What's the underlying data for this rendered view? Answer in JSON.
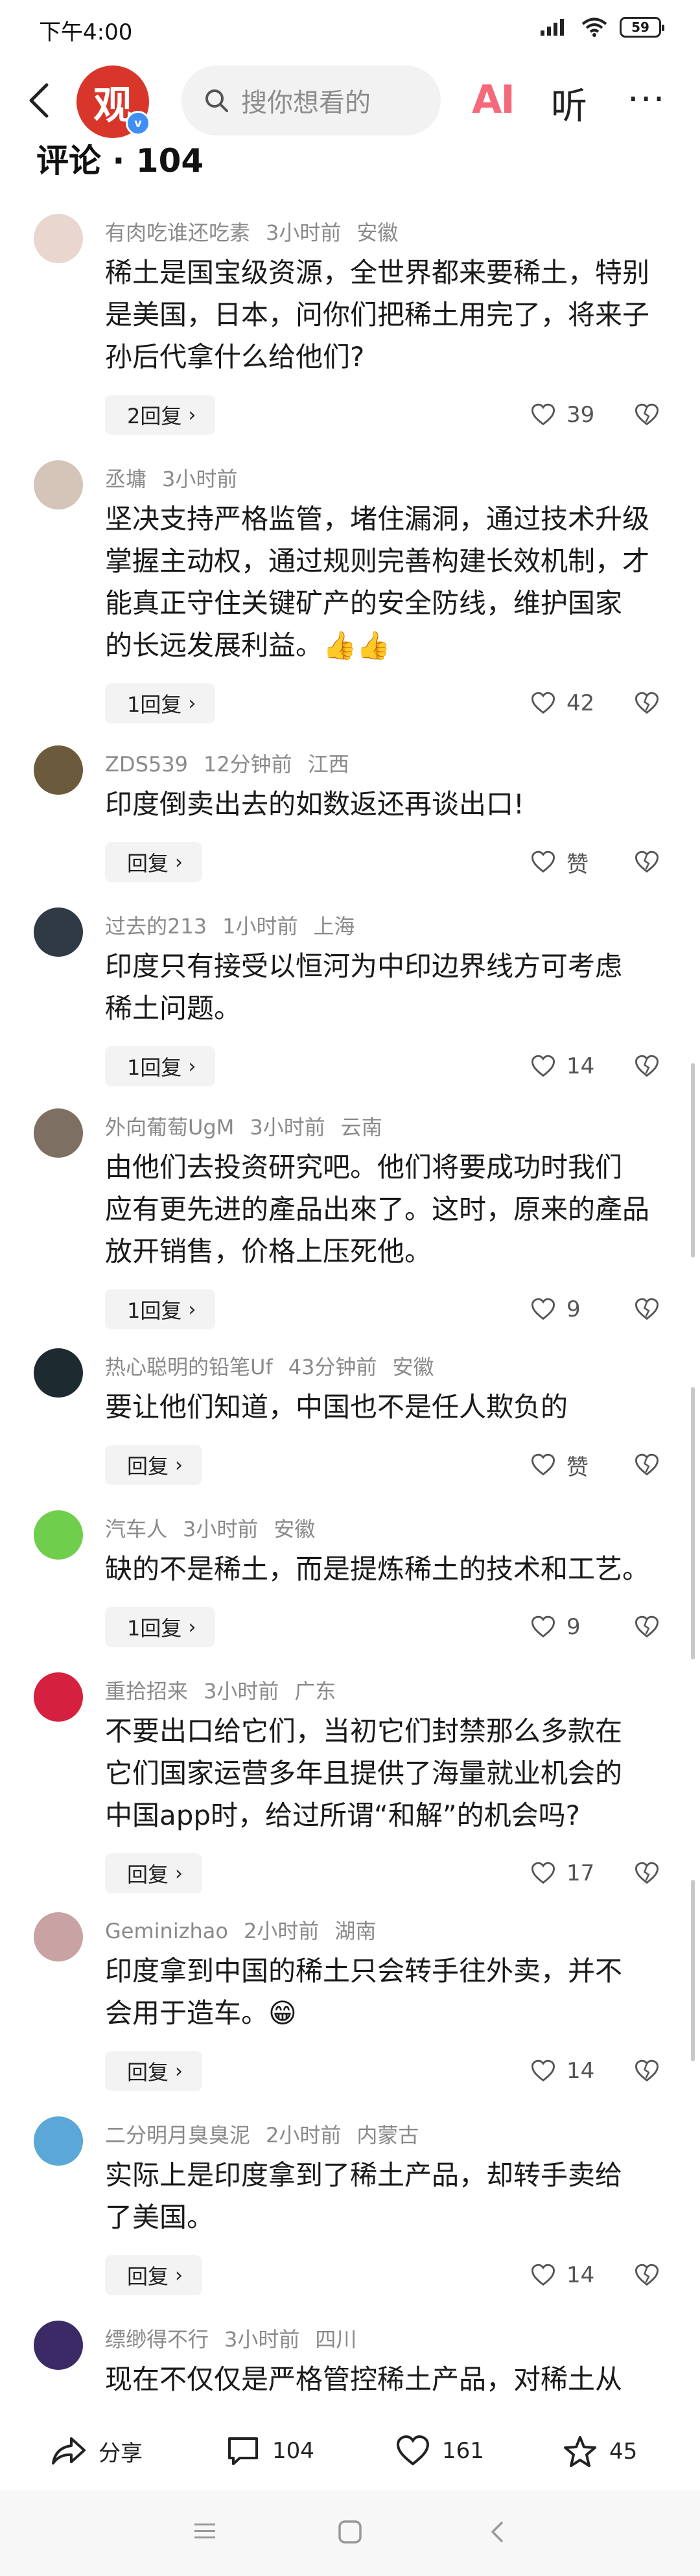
{
  "status_bar": {
    "time": "下午4:00",
    "battery": "59"
  },
  "nav": {
    "logo_text": "观",
    "search_placeholder": "搜你想看的",
    "ai_label": "AI",
    "listen_label": "听"
  },
  "comments": {
    "title": "评论 · 104",
    "items": [
      {
        "user": "有肉吃谁还吃素",
        "time": "3小时前",
        "location": "安徽",
        "lines": [
          "稀土是国宝级资源，全世界都来要稀土，特别",
          "是美国，日本，问你们把稀土用完了，将来子",
          "孙后代拿什么给他们?"
        ],
        "reply": "2回复",
        "likes": "39"
      },
      {
        "user": "丞墉",
        "time": "3小时前",
        "location": "",
        "lines": [
          "坚决支持严格监管，堵住漏洞，通过技术升级",
          "掌握主动权，通过规则完善构建长效机制，才",
          "能真正守住关键矿产的安全防线，维护国家",
          "的长远发展利益。👍👍"
        ],
        "reply": "1回复",
        "likes": "42"
      },
      {
        "user": "ZDS539",
        "time": "12分钟前",
        "location": "江西",
        "lines": [
          "印度倒卖出去的如数返还再谈出口!"
        ],
        "reply": "回复",
        "likes": "赞"
      },
      {
        "user": "过去的213",
        "time": "1小时前",
        "location": "上海",
        "lines": [
          "印度只有接受以恒河为中印边界线方可考虑",
          "稀土问题。"
        ],
        "reply": "1回复",
        "likes": "14"
      },
      {
        "user": "外向葡萄UgM",
        "time": "3小时前",
        "location": "云南",
        "lines": [
          "由他们去投资研究吧。他们将要成功时我们",
          "应有更先进的產品出來了。这时，原来的產品",
          "放开销售，价格上压死他。"
        ],
        "reply": "1回复",
        "likes": "9"
      },
      {
        "user": "热心聪明的铅笔Uf",
        "time": "43分钟前",
        "location": "安徽",
        "lines": [
          "要让他们知道，中国也不是任人欺负的"
        ],
        "reply": "回复",
        "likes": "赞"
      },
      {
        "user": "汽车人",
        "time": "3小时前",
        "location": "安徽",
        "lines": [
          "缺的不是稀土，而是提炼稀土的技术和工艺。"
        ],
        "reply": "1回复",
        "likes": "9"
      },
      {
        "user": "重拾招来",
        "time": "3小时前",
        "location": "广东",
        "lines": [
          "不要出口给它们，当初它们封禁那么多款在",
          "它们国家运营多年且提供了海量就业机会的",
          "中国app时，给过所谓“和解”的机会吗?"
        ],
        "reply": "回复",
        "likes": "17"
      },
      {
        "user": "Geminizhao",
        "time": "2小时前",
        "location": "湖南",
        "lines": [
          "印度拿到中国的稀土只会转手往外卖，并不",
          "会用于造车。😁"
        ],
        "reply": "回复",
        "likes": "14"
      },
      {
        "user": "二分明月臭臭泥",
        "time": "2小时前",
        "location": "内蒙古",
        "lines": [
          "实际上是印度拿到了稀土产品，却转手卖给",
          "了美国。"
        ],
        "reply": "回复",
        "likes": "14"
      },
      {
        "user": "缥缈得不行",
        "time": "3小时前",
        "location": "四川",
        "lines": [
          "现在不仅仅是严格管控稀土产品，对稀土从"
        ],
        "reply": "",
        "likes": ""
      }
    ]
  },
  "bottom_bar": {
    "share": "分享",
    "comments": "104",
    "likes": "161",
    "favorites": "45"
  }
}
